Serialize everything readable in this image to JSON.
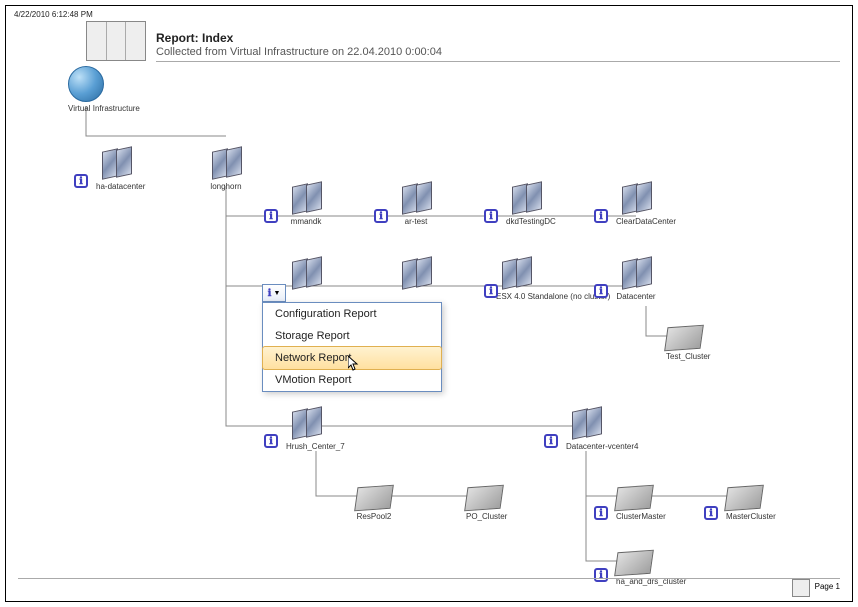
{
  "timestamp": "4/22/2010 6:12:48 PM",
  "report": {
    "title": "Report: Index",
    "subtitle": "Collected from Virtual Infrastructure on 22.04.2010 0:00:04"
  },
  "nodes": {
    "root": "Virtual Infrastructure",
    "ha": "ha-datacenter",
    "longhorn": "longhorn",
    "mmandk": "mmandk",
    "artest": "ar-test",
    "dkdtest": "dkdTestingDC",
    "cleardc": "ClearDataCenter",
    "esx40": "ESX 4.0 Standalone (no cluster)",
    "datacenter": "Datacenter",
    "testcluster": "Test_Cluster",
    "hrush": "Hrush_Center_7",
    "dcvcenter4": "Datacenter-vcenter4",
    "respool2": "ResPool2",
    "pocluster": "PO_Cluster",
    "clustermaster": "ClusterMaster",
    "mastercluster": "MasterCluster",
    "hadrs": "ha_and_drs_cluster"
  },
  "menu": {
    "items": [
      "Configuration Report",
      "Storage Report",
      "Network Report",
      "VMotion Report"
    ],
    "highlighted": 2
  },
  "footer": {
    "page": "Page 1"
  },
  "info_glyph": "ℹ"
}
